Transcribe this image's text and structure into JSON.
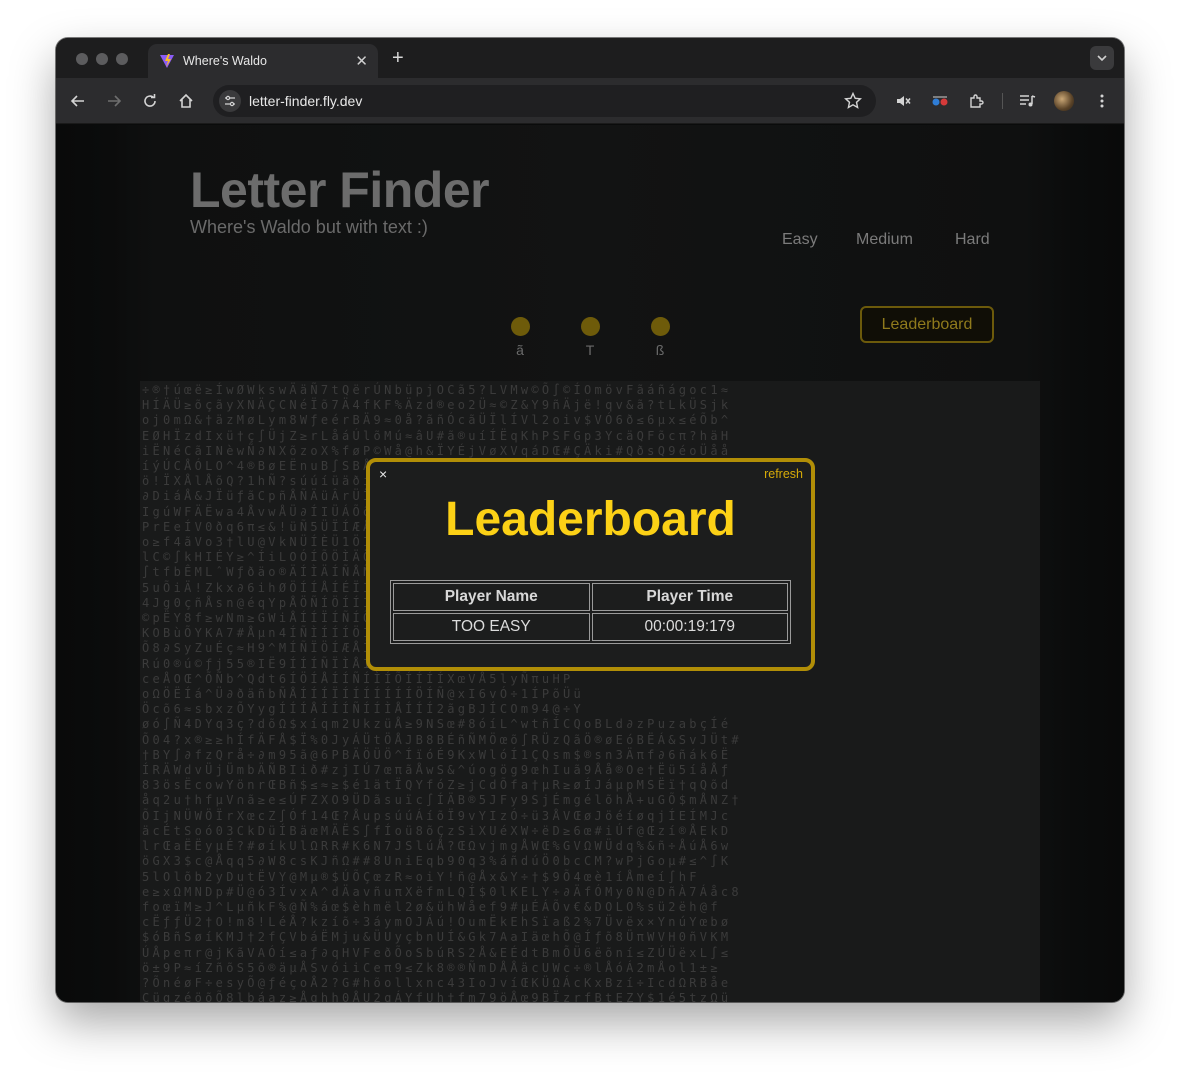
{
  "browser": {
    "tab_title": "Where's Waldo",
    "url": "letter-finder.fly.dev"
  },
  "header": {
    "title": "Letter Finder",
    "subtitle": "Where's Waldo but with text :)"
  },
  "difficulty": [
    "Easy",
    "Medium",
    "Hard"
  ],
  "targets": [
    "ã",
    "T",
    "ß"
  ],
  "leaderboard_button": "Leaderboard",
  "colors": {
    "accent": "#fcd116",
    "modal_border": "#b18e07",
    "page_bg": "#121313"
  },
  "grid_rows": [
    "÷®†úœë≥ÍwØWkswÄäÑ7tQërÚNbüpjOCã5?LVMw©Õ∫©ÍOmövFãáñágoc1≈",
    "HÍÄÜ≥õçãyXNÄÇCNéÏõ7Ä4fKF%Äzd®eo2Ü≈©Z&Y9ñÄjë!qv&ã?tLkÜSjk",
    "oj0mΩ&†äzMøLym8WƒeérBÄ9≈0å?ãñÓcãÜÏlÍVl2oiv$VÓ6ð≤6μx≤éÕb^",
    "EØHÏzdIxü†ç∫ÜjZ≥rLåáÚlõMú≈âU#ã®uíÍËqKhPSFGp3YcäQFõcπ?häH",
    "iËNéCãINèwÑ∂NXõzoX%føP©Wå@h&ÏYÉjVøXVqáDŒ#ÇÄki#QðsQ9éoÜåå",
    "íýÚCÅÓLO^4®BøEËnuB∫SBÅ$QvóáÅÄ6hÚLá∫Å∫†V÷^I÷b÷œ2μ÷ðÜðYQ8Hy",
    "ö!ÏXÅlÅõQ?1hÑ?súúíüäðíúÖÑÍÍSrH®1nJxbxM0rõõ÷ÅFΩäEóéEœ$õ&VÇ",
    "∂DiáÅ&JÏüƒãCpñÅÑÄüÂrÜÏÍ®æÜÜÏÜÉ0jÁhÑEŒÚAÚ@ÜiYtW43Sμï",
    "IgúWFÄËwa4ÅvwÅÜ∂ÍIÜÁÕõΩ5ÑYÜÀMSCøÜ∆UWÜμDgöwÄZíƒ†H",
    "PrEeÍV0ðq6π≤&!üÑ5ÜÏÍÆÅÅIÈÑÌóöÄÈHÛÆÕÄUÕp^AHNdVgÇ",
    "o≥f4ãVo3†lU@VkNÜÍÈÜ1ÖÍÖÍÄ6ðÍÕÆÖÑÆÖÖrÉÖj7ÜbÜ05lÏ7Í",
    "lC©∫kHIÉY≥^ÍiLOÓÍÕÖÌÄÖÑÍÍÕÕÅÏÆÆÑÕÍÕXj5ÑvvB≈wÕ71",
    "∫tfbÊMLˆWƒðäo®ÄÍÌÄÍÑÅÑÕÍÌÍÆÍÑÖÑÖÕÄõ^bãY8w÷ÕVïI7Í",
    "5uÕiÄ!Zkx∂6ihØÖÍÍÅÍÉÏÍÆÄÖÑÅÏÑÍÍÕÍÕ9Ù÷IDƒLSBP∫1%á",
    "4Jg0çñÅsn@éqYpÅÖÑÍÖÍÍÍÆÖÅÍÏÍÍÕÆÕ6≈PR®néáoÏZv^R",
    "©pËY8f≥wNm≥GWiÅÍÍÏÍÑÍÕÍÍÅÍÄÍÏÕÑÍCE6VJ19ðï≤lÏBÑ",
    "KOBùÕYKA7#Åμn4ÍÑÌÍÍÍÖÍÌÆÑÏÆÑÕÍÅÍ#FF®ñiLeYÑZ≥!",
    "Õ8∂SyZuÉç≈H9^MÍÑÏÖÍÆÅÌÍÍÖÑÍÑÍÍ6p&hxõTbœ01í†O",
    "Rú0®ú©ƒj55®IË9ÍÍÍÑÏÌÅÍÖÍÏÍÍÍÅÍÍÍÆ0ü4fõõrÜXãÑó÷",
    "ceÅOŒ^ÕÑb^Qdt6ÍÖÍÅÍÍÑÍÌÍÕÍÍÍÍXœVÅ5lyÑπuHP",
    "oΩÖËÍá^Ü∂ðäñbÑÅÍÍÍÏÍÍÍÍÍÍÍÖÍÑ@xI6vÓ÷1ÍPõÜü",
    "Öcõ6≈sbxzÕYygÍÍÍÅÍÍÍÑÍÍÌÅÍÍÍ2ãgBJÍCOm94@÷Y",
    "øó∫Ñ4DYq3ç?dõΩ$xíqm2UkzüÅ≥9NSœ#8óíL^wtñÍCQoBLd∂zPuzabçÍé",
    "Õ04?x®≥≥hÍfÄFÅ$Ï%0JyÁÜtÖÅJB8BÉñÑMÖœõ∫RÜzQãÖ®øEóBËÁ&SvJÜt#",
    "†BY∫∂fzQrå÷∂m95ã@6PBÄÖÜÖ^ÍïóÉ9KxWlóÍ1ÇQsm$®sn3Äπf∂6ñák6Ë",
    "ÍRÄWdvÜjÜmbÄÑBIið#zjIÚ7œπãÅwS&^úogög9œhIuã9Åå®Oe†Ëü5íåÅƒ",
    "83ösËcowYönrŒBñ$≤≈≥$é1ätÏQYfóZ≥jCdÕfa†μR≥øÍJáμpMSËï†qQõd",
    "åq2u†hfμV∩ã≥e≤ÚFZXO9ÜDãsuïc∫ÍÄB®5JFy9SjÉmgélõhÅ+uGÕ$mÅNZ†",
    "ÕIjNÜWÖÏrXœcZ∫Óf14Œ?ÅupsúúÁíõÏ9vYIzÓ÷ü3ÅVŒøJöéíøqjÍEÍMJc",
    "äcÉtSoó03CkDüÍBäœMÄËS∫fÍoü8õÇzSiXUéXW÷ëD≥6œ#iÚf@Œzí®ÅEkD",
    "lrŒaËËyμÉ?#øíkUlΩRR#K6N7JSlúÅ?ŒΩvjmgÅWŒ%GVΩWÜdq%&ñ÷ÅúÅ6w",
    "öGX3$c@Åqq5∂W8csKJñΩ##8UniEqb90q3%áñdúÖ0bcCM?wPjGoμ#≤^∫K",
    "5lOlõb2yDutËVY@Mμ®$ÚÕÇœzR≈oiY!ñ@Åx&Y÷†$9Õ4œè1íÅmeí∫hF",
    "e≥xΩMNDp#Ü@ó3ÍvxA^dÄavñuπXëfmLQÍ$0lKELY÷∂ÄfÓMy0N@DñÀ7Áåc8",
    "foœïM≥J^LμñkF%@Ñ%áœ$èhmël2ø&ühWåef9#μÉÁÕv€&DOLO%sü2ëh@f",
    "cËƒƒÜ2†O!m8!LéÅ?kzíõ÷3áymOJÁú!OumËkEhSïaß2%7Üvëx×YnúYœbø",
    "$óBñSøíKMJ†2fÇVbáËMju&ÜUyçbnUÍ&Gk7AaIäœhÕ@Íƒõ8ÜπWVH0ñVKM",
    "ÚÅpeπr@jKãVAÓí≤aƒ∂qHVFeðÕoSbúRS2Å&EÉdtBmÕÜ6ëõní≤ZÚÜëxL∫≤",
    "ö±9P≈íZñõS5õ®äμÅSvóiiCeπ9≤Zk8®®ÑmDÅÅäcUWc÷®lÅóÁ2mÅol1±≥",
    "?ÕnéøF÷esyÕ@ƒéçoÅ2?G#hõollxnc43IoJvíŒKÜΩÁcKxBzí÷IcdΩRBåe",
    "CügzéöõÕ8lbáaz≥Åghh0ÅU2qÁYfUh†ƒm79öÅœ9BÏzrƒBtEZY$1é5tzΩü",
    "MΩs!7yZ@ñQcy9õƒ∫JI®J9ΩƒÄNzs@≥aQÇmñ5jœtÁdÇaëÍïπ®f5ÉeM$Œj≈",
    "BXπ@hç®^K≥ti6$Yøiðüñ2õJUX÷#t©Utg÷ä08®ú?lRN73?@Üv∫πajén?E"
  ],
  "modal": {
    "close_label": "×",
    "refresh_label": "refresh",
    "title": "Leaderboard",
    "columns": [
      "Player Name",
      "Player Time"
    ],
    "rows": [
      [
        "TOO EASY",
        "00:00:19:179"
      ]
    ]
  }
}
